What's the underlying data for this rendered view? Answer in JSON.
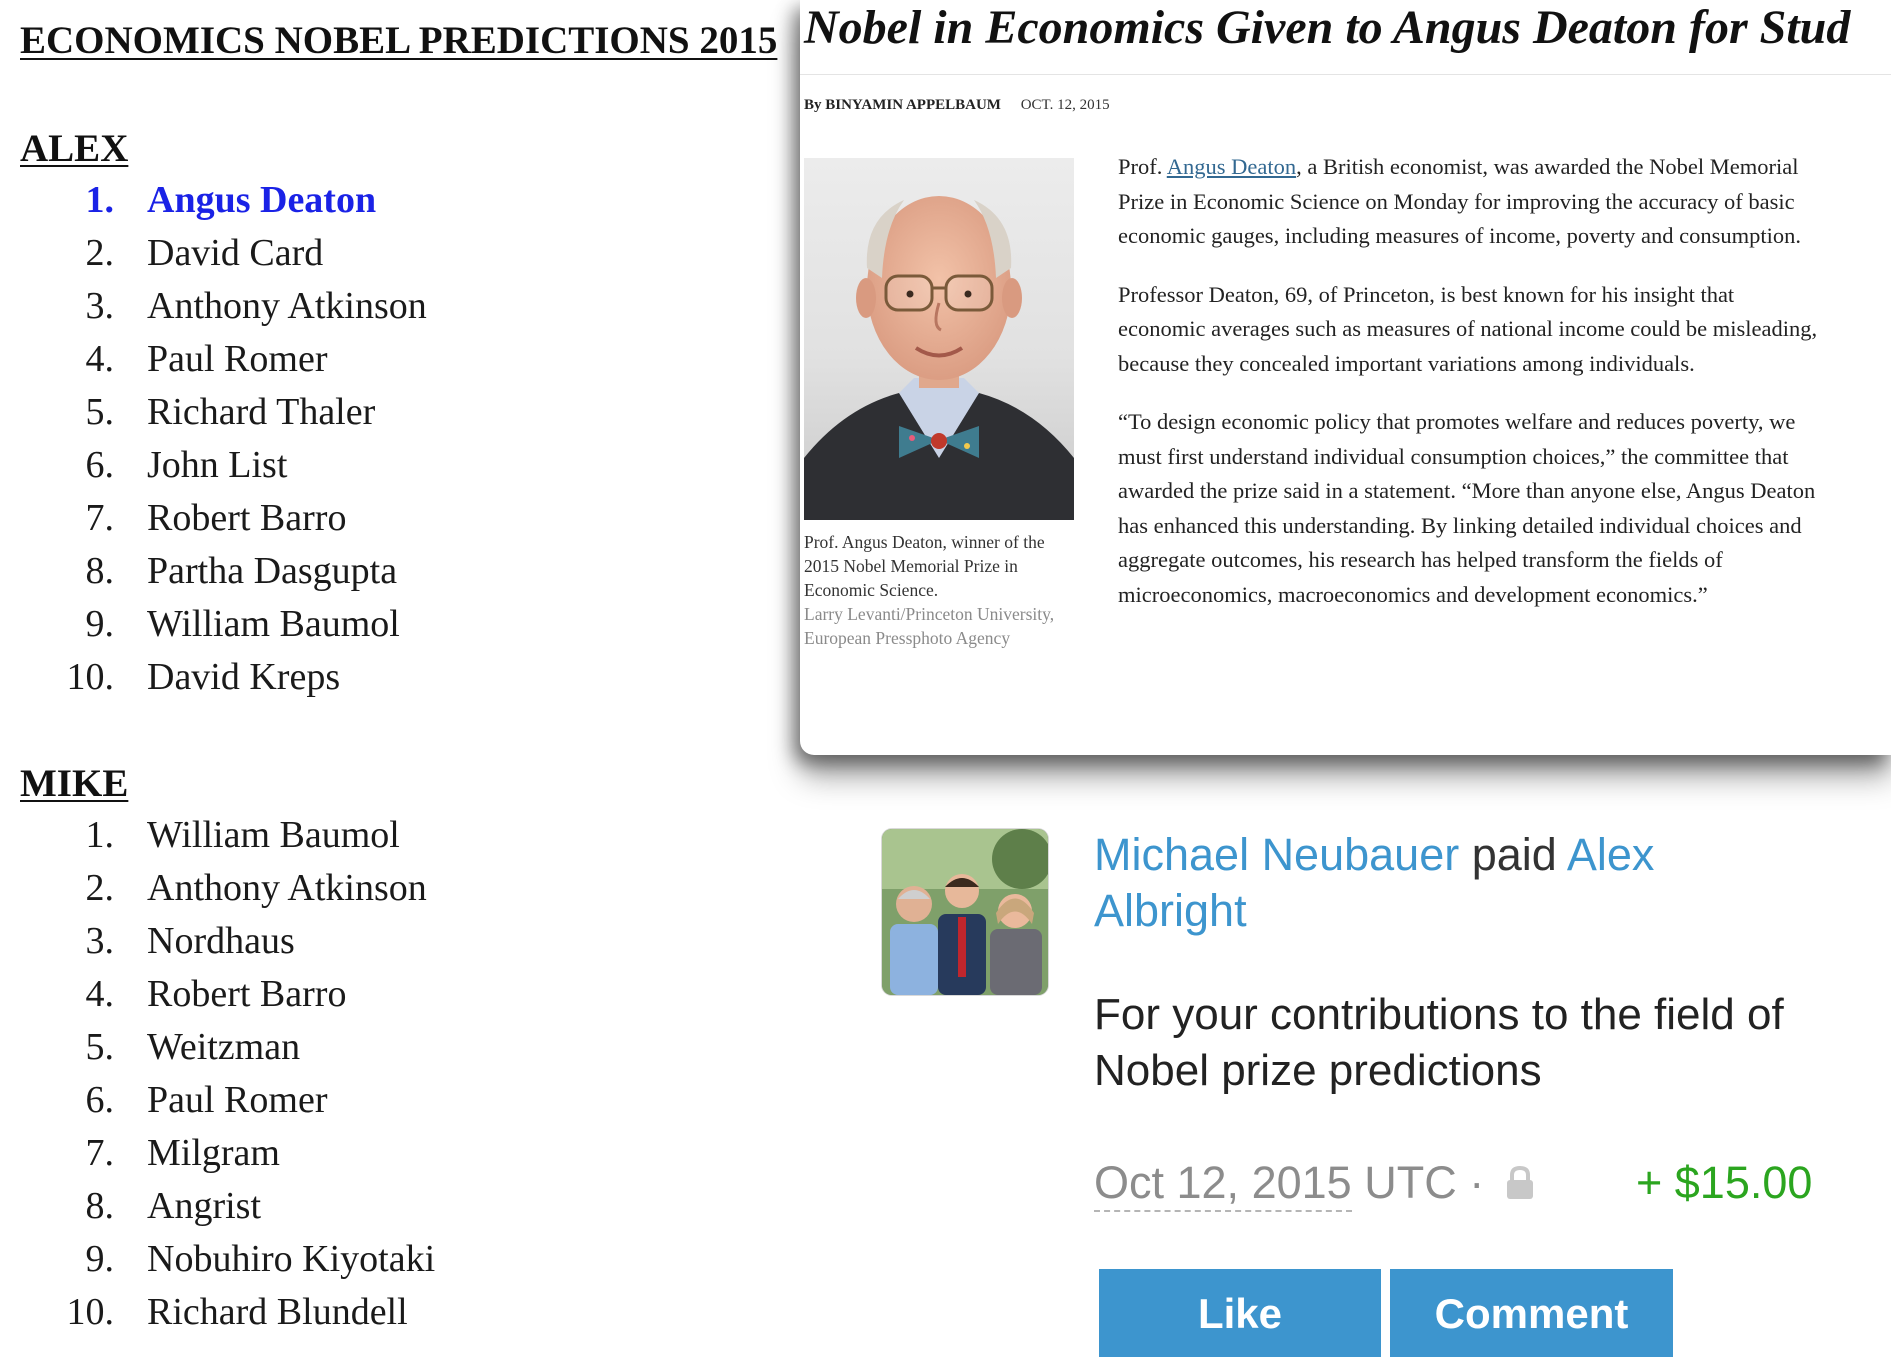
{
  "predictions": {
    "title": "ECONOMICS NOBEL PREDICTIONS 2015",
    "lists": [
      {
        "heading": "ALEX",
        "items": [
          {
            "num": "1.",
            "name": "Angus Deaton",
            "highlight": true
          },
          {
            "num": "2.",
            "name": "David Card"
          },
          {
            "num": "3.",
            "name": "Anthony Atkinson"
          },
          {
            "num": "4.",
            "name": "Paul Romer"
          },
          {
            "num": "5.",
            "name": "Richard Thaler"
          },
          {
            "num": "6.",
            "name": "John List"
          },
          {
            "num": "7.",
            "name": "Robert Barro"
          },
          {
            "num": "8.",
            "name": "Partha Dasgupta"
          },
          {
            "num": "9.",
            "name": "William Baumol"
          },
          {
            "num": "10.",
            "name": "David Kreps"
          }
        ]
      },
      {
        "heading": "MIKE",
        "items": [
          {
            "num": "1.",
            "name": "William Baumol"
          },
          {
            "num": "2.",
            "name": "Anthony Atkinson"
          },
          {
            "num": "3.",
            "name": "Nordhaus"
          },
          {
            "num": "4.",
            "name": "Robert Barro"
          },
          {
            "num": "5.",
            "name": "Weitzman"
          },
          {
            "num": "6.",
            "name": "Paul Romer"
          },
          {
            "num": "7.",
            "name": "Milgram"
          },
          {
            "num": "8.",
            "name": "Angrist"
          },
          {
            "num": "9.",
            "name": "Nobuhiro Kiyotaki"
          },
          {
            "num": "10.",
            "name": "Richard Blundell"
          }
        ]
      }
    ]
  },
  "article": {
    "headline": "Nobel in Economics Given to Angus Deaton for Stud",
    "byline_author": "By BINYAMIN APPELBAUM",
    "byline_date": "OCT. 12, 2015",
    "photo_icon": "portrait-photo",
    "caption": "Prof. Angus Deaton, winner of the 2015 Nobel Memorial Prize in Economic Science.",
    "credit": "Larry Levanti/Princeton University, European Pressphoto Agency",
    "p1_before": "Prof. ",
    "p1_link": "Angus Deaton",
    "p1_after": ", a British economist, was awarded the Nobel Memorial Prize in Economic Science on Monday for improving the accuracy of basic economic gauges, including measures of income, poverty and consumption.",
    "p2": "Professor Deaton, 69, of Princeton, is best known for his insight that economic averages such as measures of national income could be misleading, because they concealed important variations among individuals.",
    "p3": "“To design economic policy that promotes welfare and reduces poverty, we must first understand individual consumption choices,” the committee that awarded the prize said in a statement. “More than anyone else, Angus Deaton has enhanced this understanding. By linking detailed individual choices and aggregate outcomes, his research has helped transform the fields of microeconomics, macroeconomics and development economics.”"
  },
  "payment": {
    "avatar_icon": "group-photo-avatar",
    "payer": "Michael Neubauer",
    "verb": "paid",
    "payee": "Alex Albright",
    "note": "For your contributions to the field of Nobel prize predictions",
    "date": "Oct 12, 2015",
    "timezone": "UTC",
    "separator": "·",
    "privacy_icon": "lock-icon",
    "amount": "+ $15.00",
    "like_label": "Like",
    "comment_label": "Comment",
    "colors": {
      "venmo_blue": "#3d95ce",
      "amount_green": "#2ba51f",
      "highlight_blue": "#1a22e6",
      "link_blue": "#326891"
    }
  }
}
